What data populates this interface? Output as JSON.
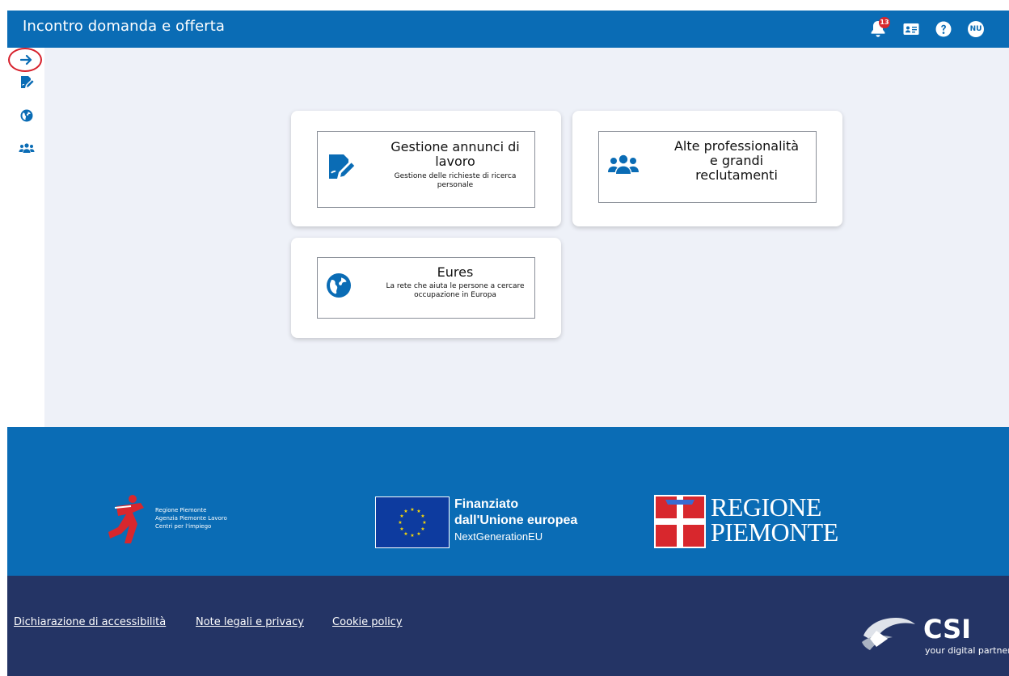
{
  "header": {
    "title": "Incontro domanda e offerta",
    "notification_count": "13",
    "user_initials": "NU"
  },
  "sidebar": {
    "items": [
      {
        "icon": "arrow-right-icon"
      },
      {
        "icon": "edit-document-icon"
      },
      {
        "icon": "globe-icon"
      },
      {
        "icon": "users-icon"
      }
    ]
  },
  "cards": {
    "gestione": {
      "title": "Gestione annunci di lavoro",
      "subtitle": "Gestione delle richieste di ricerca personale"
    },
    "alte": {
      "title": "Alte professionalità e grandi reclutamenti"
    },
    "eures": {
      "title": "Eures",
      "subtitle": "La rete che aiuta le persone a cercare occupazione in Europa"
    }
  },
  "footer": {
    "logo_lines": [
      "Regione Piemonte",
      "Agenzia Piemonte Lavoro",
      "Centri per l'impiego"
    ],
    "eu_line1": "Finanziato",
    "eu_line2": "dall'Unione europea",
    "eu_line3": "NextGenerationEU",
    "regione_line1": "REGIONE",
    "regione_line2": "PIEMONTE",
    "links": [
      "Dichiarazione di accessibilità",
      "Note legali e privacy",
      "Cookie policy"
    ],
    "csi_name": "CSI",
    "csi_tagline": "your digital partner"
  },
  "colors": {
    "primary": "#0a6cb5",
    "dark_footer": "#243465",
    "page_bg": "#eef1f8",
    "badge": "#d8272d"
  }
}
